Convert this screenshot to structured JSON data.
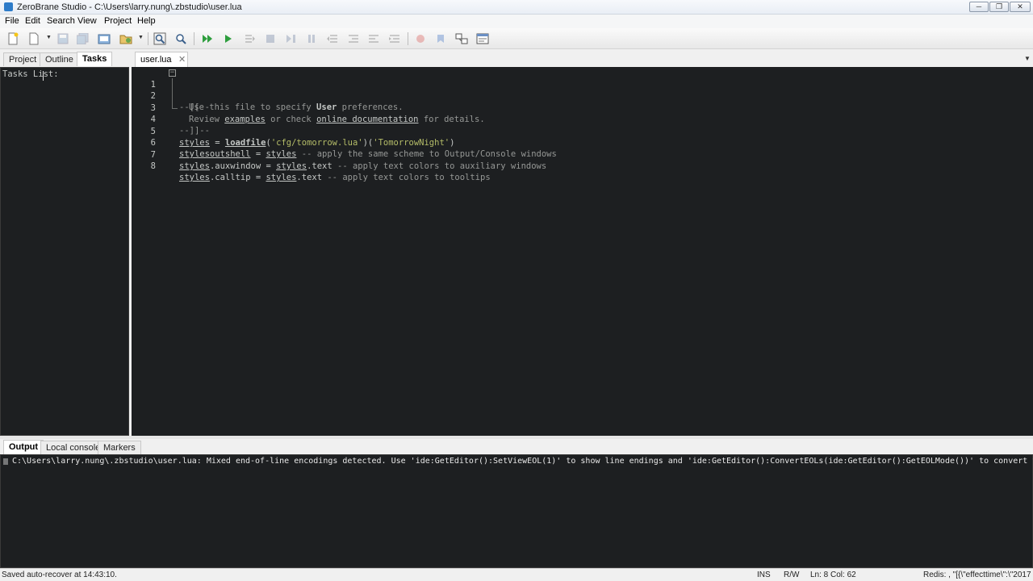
{
  "window": {
    "title": "ZeroBrane Studio - C:\\Users\\larry.nung\\.zbstudio\\user.lua"
  },
  "menu": [
    "File",
    "Edit",
    "Search",
    "View",
    "Project",
    "Help"
  ],
  "toolbar": {
    "icons": [
      "new-file-icon",
      "open-file-icon",
      "save-icon",
      "save-all-icon",
      "project-directory-icon",
      "recent-projects-icon",
      "find-icon",
      "find-in-files-icon",
      "run-icon",
      "start-debug-icon",
      "step-into-icon",
      "stop-debug-icon",
      "step-over-icon",
      "break-icon",
      "step-out-icon",
      "run-to-cursor-icon",
      "toggle-breakpoint-icon",
      "toggle-bookmark-icon",
      "stack-window-icon",
      "watch-window-icon"
    ]
  },
  "left_panel": {
    "tabs": [
      "Project",
      "Outline",
      "Tasks"
    ],
    "active_tab": "Tasks",
    "tasks_label": "Tasks List:"
  },
  "editor": {
    "tab_label": "user.lua",
    "line_numbers": [
      "1",
      "2",
      "3",
      "4",
      "5",
      "6",
      "7",
      "8"
    ],
    "l1": "--[[--",
    "l2a": "Use this file to specify ",
    "l2b": "User",
    "l2c": " preferences.",
    "l3a": "Review ",
    "l3b": "examples",
    "l3c": " or check ",
    "l3d": "online documentation",
    "l3e": " for details.",
    "l4": "--]]--",
    "l5a": "styles",
    "l5b": " = ",
    "l5c": "loadfile",
    "l5d": "(",
    "l5e": "'cfg/tomorrow.lua'",
    "l5f": ")(",
    "l5g": "'TomorrowNight'",
    "l5h": ")",
    "l6a": "stylesoutshell",
    "l6b": " = ",
    "l6c": "styles",
    "l6d": " -- apply the same scheme to Output/Console windows",
    "l7a": "styles",
    "l7b": ".auxwindow = ",
    "l7c": "styles",
    "l7d": ".text",
    "l7e": " -- apply text colors to auxiliary windows",
    "l8a": "styles",
    "l8b": ".calltip = ",
    "l8c": "styles",
    "l8d": ".text",
    "l8e": " -- apply text colors to tooltips"
  },
  "bottom_panel": {
    "tabs": [
      "Output",
      "Local console",
      "Markers"
    ],
    "active_tab": "Output",
    "output_text": "C:\\Users\\larry.nung\\.zbstudio\\user.lua: Mixed end-of-line encodings detected. Use 'ide:GetEditor():SetViewEOL(1)' to show line endings and 'ide:GetEditor():ConvertEOLs(ide:GetEditor():GetEOLMode())' to convert them."
  },
  "statusbar": {
    "message": "Saved auto-recover at 14:43:10.",
    "mode": "INS",
    "access": "R/W",
    "position": "Ln: 8 Col: 62",
    "redis": "Redis: , \"[{\\\"effecttime\\\":\\\"2017"
  }
}
